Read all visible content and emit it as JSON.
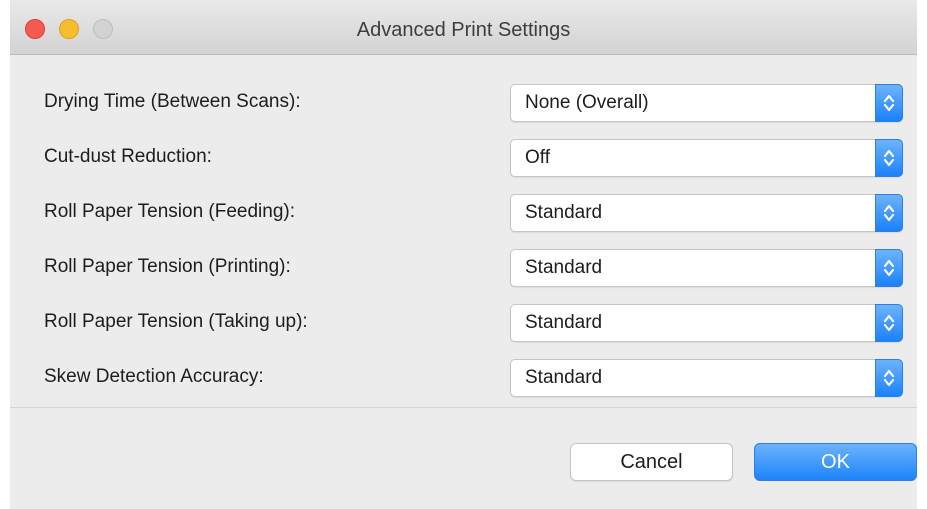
{
  "window": {
    "title": "Advanced Print Settings"
  },
  "settings": [
    {
      "label": "Drying Time (Between Scans):",
      "value": "None (Overall)"
    },
    {
      "label": "Cut-dust Reduction:",
      "value": "Off"
    },
    {
      "label": "Roll Paper Tension (Feeding):",
      "value": "Standard"
    },
    {
      "label": "Roll Paper Tension (Printing):",
      "value": "Standard"
    },
    {
      "label": "Roll Paper Tension (Taking up):",
      "value": "Standard"
    },
    {
      "label": "Skew Detection Accuracy:",
      "value": "Standard"
    }
  ],
  "buttons": {
    "cancel": "Cancel",
    "ok": "OK"
  },
  "colors": {
    "accent": "#1a82fb",
    "close": "#f45a52",
    "minimize": "#f8bd2d",
    "zoom": "#d2d2d2"
  },
  "icons": {
    "popup_arrows": "up-down-chevron-icon"
  }
}
